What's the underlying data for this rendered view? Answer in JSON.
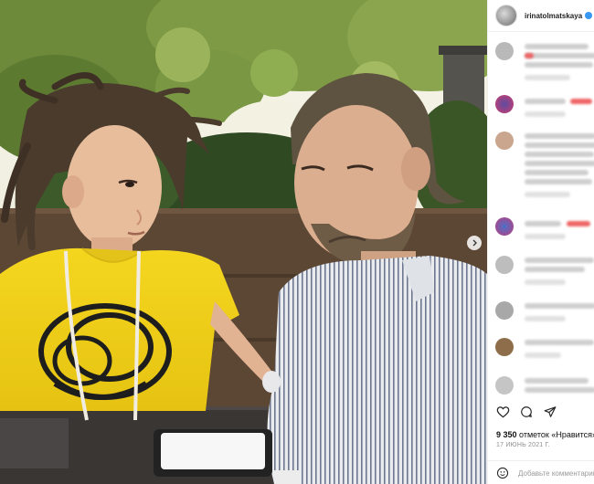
{
  "post": {
    "username": "irinatolmatskaya",
    "verified": true,
    "likes_count": "9 350",
    "likes_suffix": "отметок «Нравится»",
    "date": "17 ИЮНЬ 2021 Г.",
    "add_comment_placeholder": "Добавьте комментарий..."
  },
  "icons": {
    "like": "heart-icon",
    "comment": "comment-icon",
    "share": "paper-plane-icon",
    "emoji": "smile-icon",
    "next": "chevron-right-icon"
  },
  "colors": {
    "verified": "#3897f0",
    "shirt": "#f2d21f",
    "accent_red": "#ed4956"
  }
}
